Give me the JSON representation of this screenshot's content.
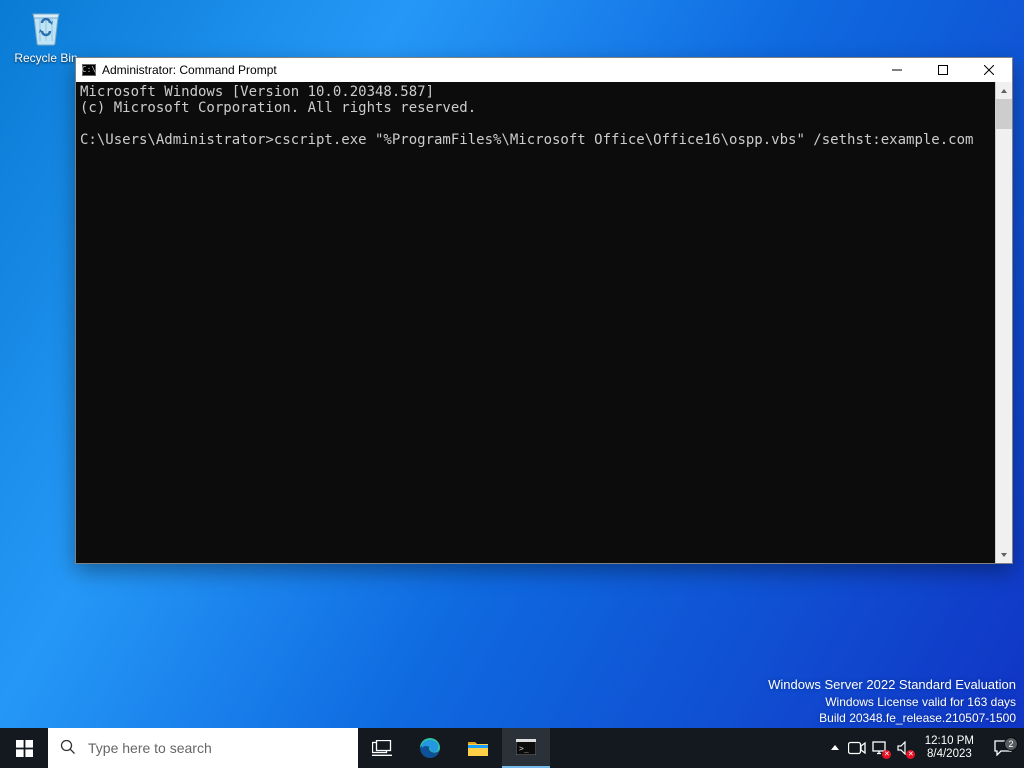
{
  "desktop": {
    "recycle_bin_label": "Recycle Bin"
  },
  "watermark": {
    "line1": "Windows Server 2022 Standard Evaluation",
    "line2": "Windows License valid for 163 days",
    "line3": "Build 20348.fe_release.210507-1500"
  },
  "window": {
    "title": "Administrator: Command Prompt",
    "icon_label": "C:\\",
    "terminal_lines": [
      "Microsoft Windows [Version 10.0.20348.587]",
      "(c) Microsoft Corporation. All rights reserved.",
      "",
      "C:\\Users\\Administrator>cscript.exe \"%ProgramFiles%\\Microsoft Office\\Office16\\ospp.vbs\" /sethst:example.com"
    ]
  },
  "taskbar": {
    "search_placeholder": "Type here to search",
    "clock_time": "12:10 PM",
    "clock_date": "8/4/2023",
    "notif_count": "2"
  }
}
